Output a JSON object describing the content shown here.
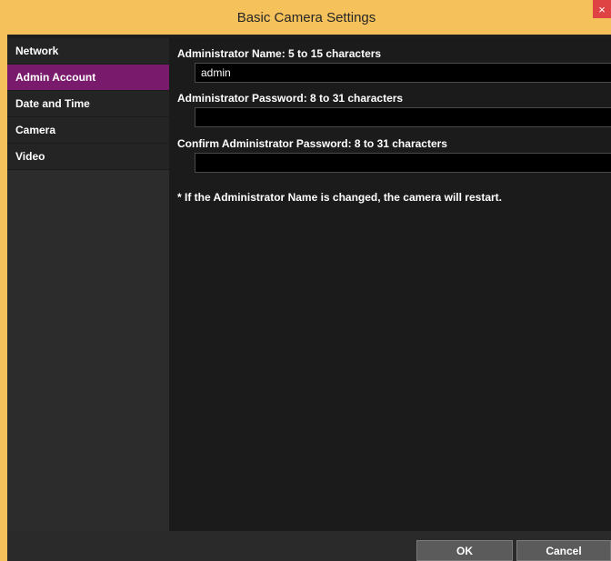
{
  "window": {
    "title": "Basic Camera Settings",
    "close_glyph": "×"
  },
  "sidebar": {
    "items": [
      {
        "label": "Network",
        "active": false
      },
      {
        "label": "Admin Account",
        "active": true
      },
      {
        "label": "Date and Time",
        "active": false
      },
      {
        "label": "Camera",
        "active": false
      },
      {
        "label": "Video",
        "active": false
      }
    ]
  },
  "form": {
    "admin_name_label": "Administrator Name:  5 to 15 characters",
    "admin_name_value": "admin",
    "admin_password_label": "Administrator Password:  8 to 31 characters",
    "admin_password_value": "",
    "confirm_password_label": "Confirm Administrator Password:  8 to 31 characters",
    "confirm_password_value": "",
    "note": "* If the Administrator Name is changed, the camera will restart."
  },
  "footer": {
    "ok_label": "OK",
    "cancel_label": "Cancel"
  },
  "colors": {
    "title_bar": "#f4c15a",
    "active_item": "#7a1a6d",
    "close_button": "#e04343"
  }
}
